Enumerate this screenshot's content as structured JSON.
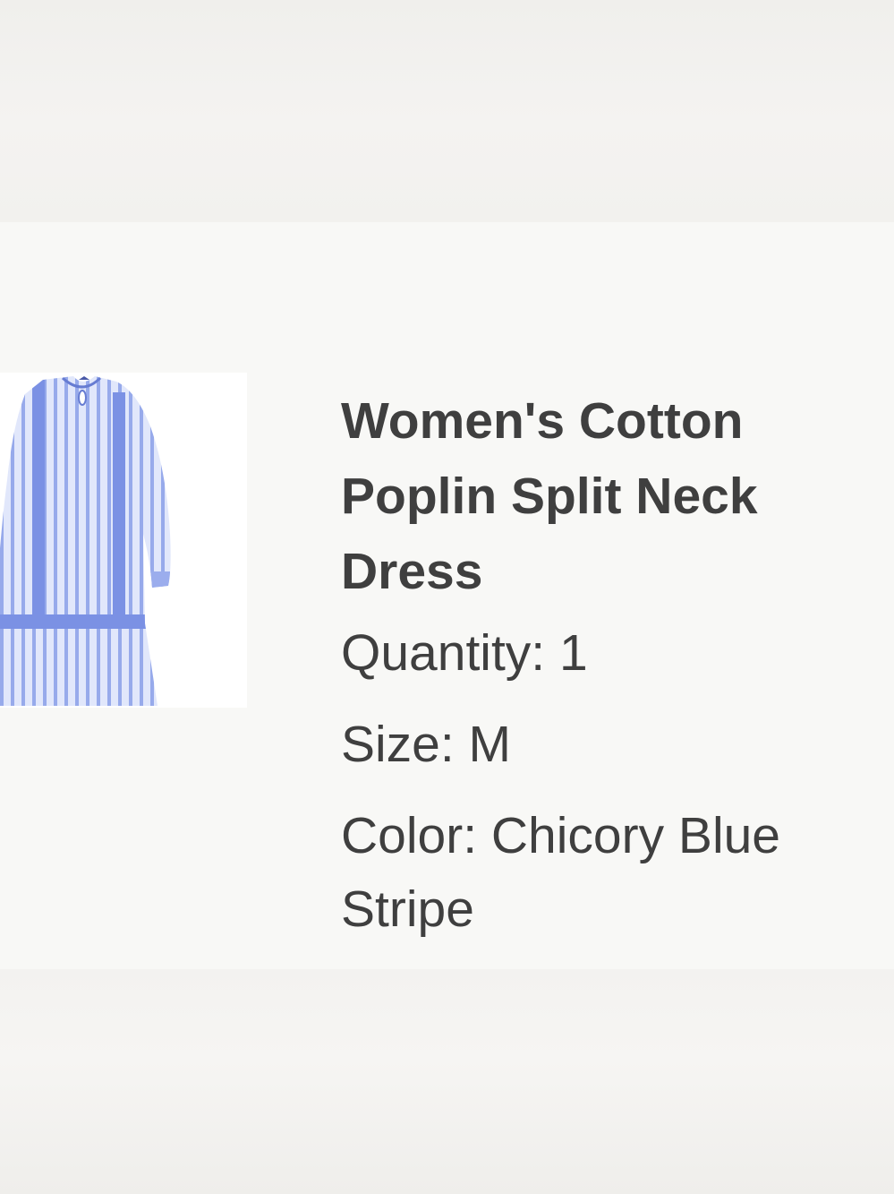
{
  "product": {
    "title": "Women's Cotton Poplin Split Neck Dress",
    "image": "striped-dress-thumbnail",
    "quantity_text": "Quantity: 1",
    "size_text": "Size: M",
    "color_text": "Color: Chicory Blue Stripe"
  },
  "colors": {
    "text": "#3f3f3f",
    "card_background": "#f8f8f6",
    "page_background": "#efeeeb",
    "dress_stripe": "#6f87e0",
    "dress_base": "#d3dcfa"
  }
}
